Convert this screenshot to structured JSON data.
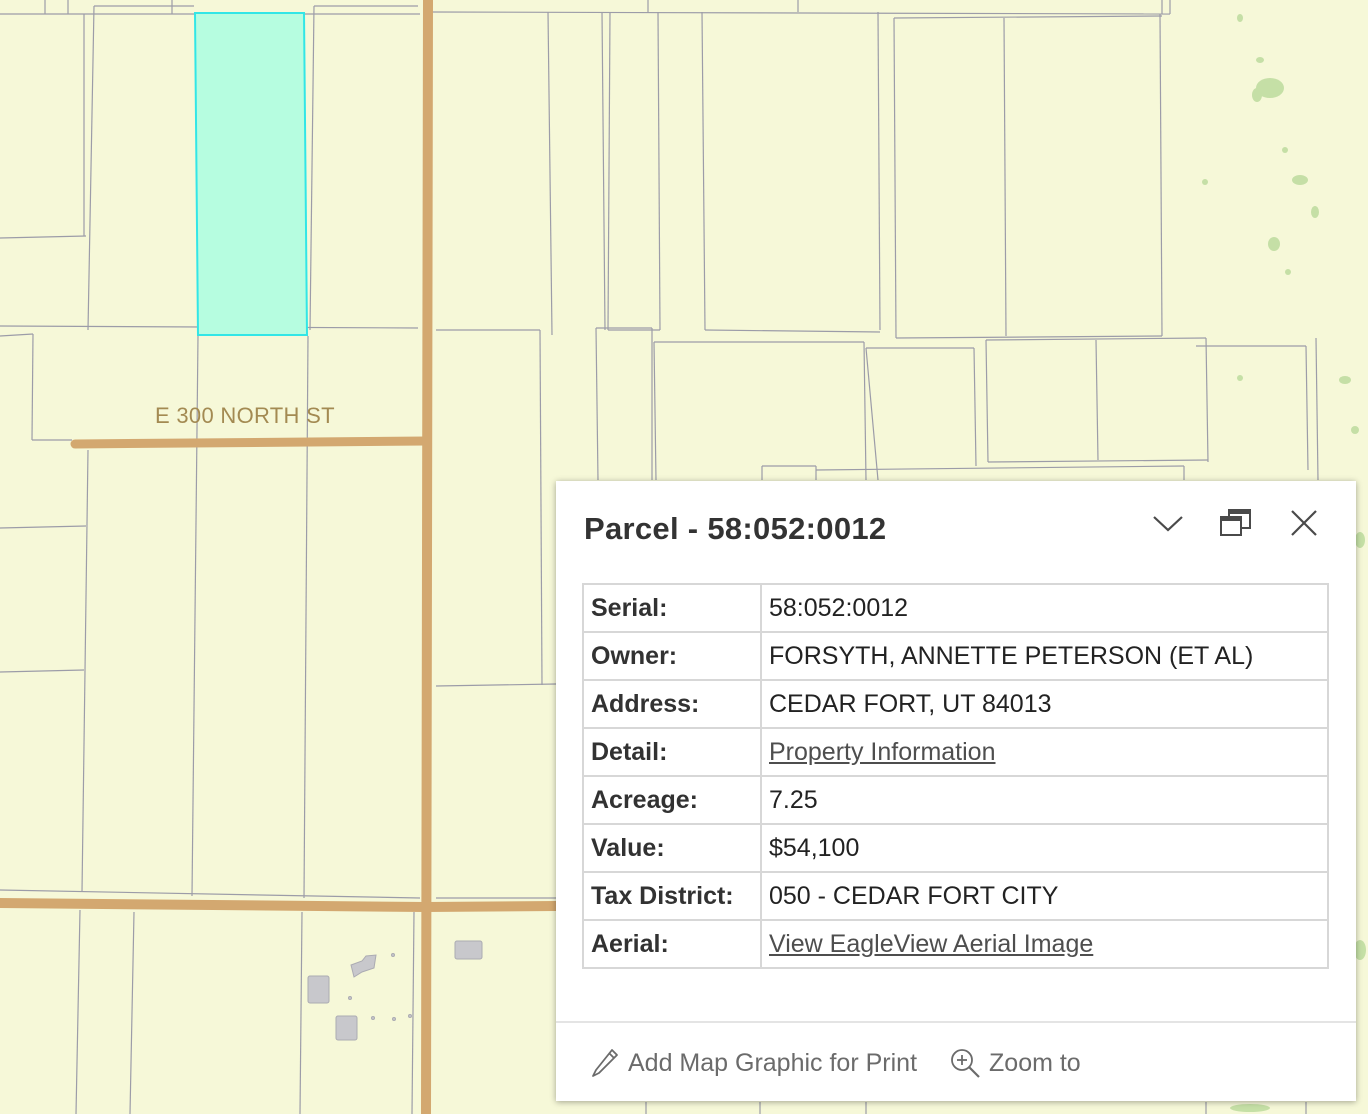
{
  "map": {
    "street_label": "E 300 NORTH ST",
    "colors": {
      "background": "#f6f8d8",
      "parcel_line": "#9c9ca8",
      "road": "#d3a870",
      "selected_fill": "#b6fde0",
      "selected_outline": "#32e6e6",
      "building": "#c8c8cc"
    }
  },
  "popup": {
    "title": "Parcel - 58:052:0012",
    "icons": {
      "collapse": "chevron-down-icon",
      "dock": "dock-icon",
      "close": "close-icon"
    },
    "fields": [
      {
        "label": "Serial:",
        "value": "58:052:0012"
      },
      {
        "label": "Owner:",
        "value": "FORSYTH, ANNETTE PETERSON (ET AL)"
      },
      {
        "label": "Address:",
        "value": "CEDAR FORT, UT 84013"
      },
      {
        "label": "Detail:",
        "value": "Property Information"
      },
      {
        "label": "Acreage:",
        "value": "7.25"
      },
      {
        "label": "Value:",
        "value": "$54,100"
      },
      {
        "label": "Tax District:",
        "value": "050 - CEDAR FORT CITY"
      },
      {
        "label": "Aerial:",
        "value": "View EagleView Aerial Image"
      }
    ],
    "actions": {
      "add_graphic_label": "Add Map Graphic for Print",
      "zoom_label": "Zoom to"
    }
  }
}
